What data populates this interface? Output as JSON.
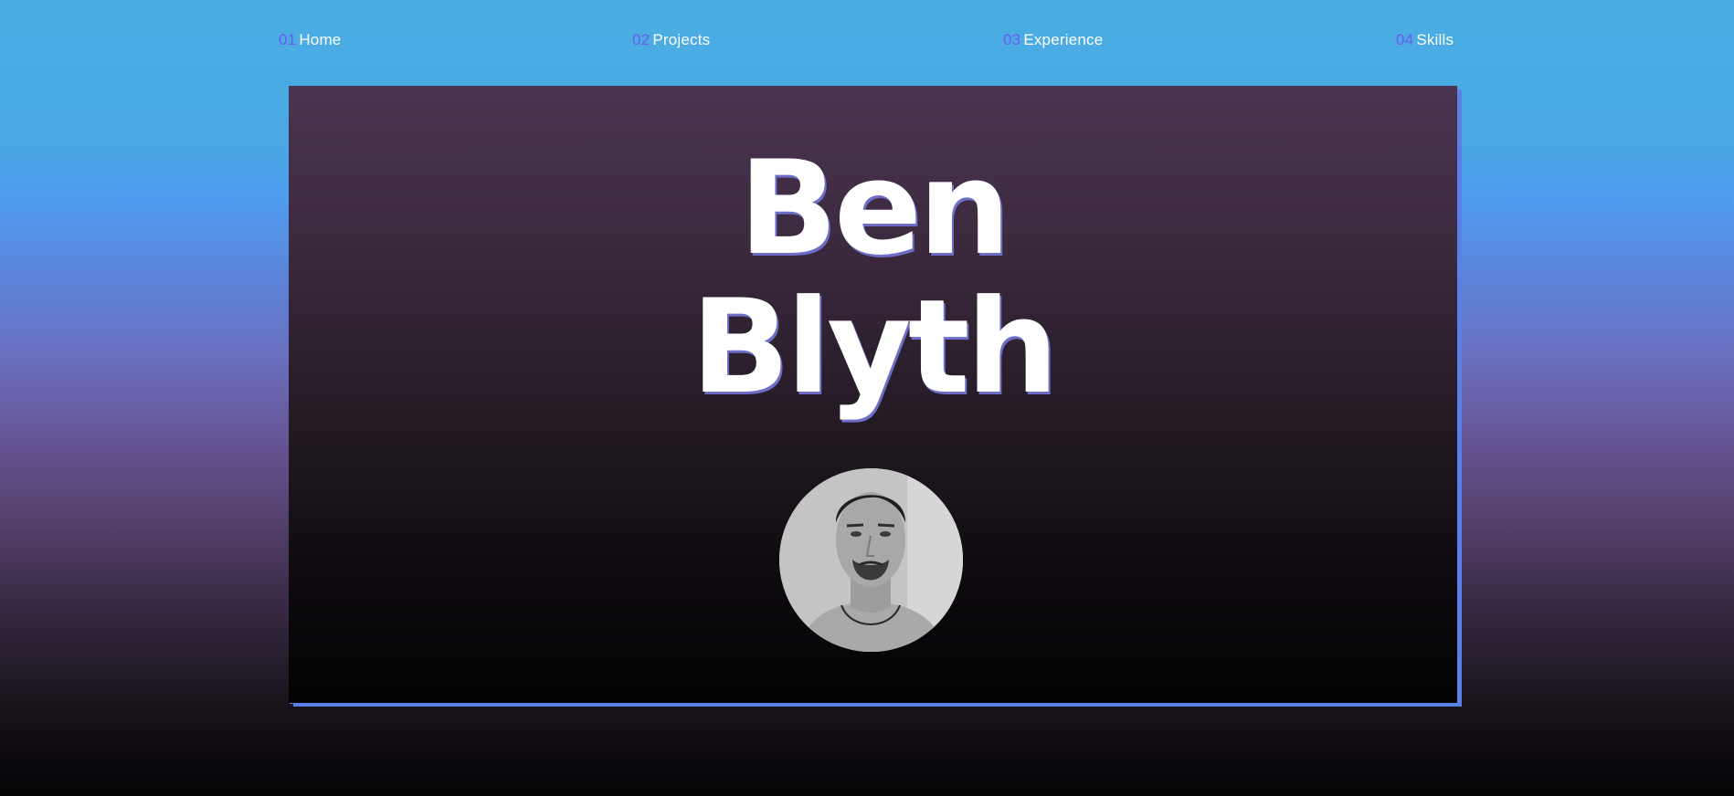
{
  "nav": {
    "items": [
      {
        "num": "01",
        "label": "Home"
      },
      {
        "num": "02",
        "label": "Projects"
      },
      {
        "num": "03",
        "label": "Experience"
      },
      {
        "num": "04",
        "label": "Skills"
      }
    ]
  },
  "hero": {
    "first_name": "Ben",
    "last_name": "Blyth"
  },
  "colors": {
    "nav_number": "#6a5cf0",
    "card_border": "#5a7fe6",
    "text": "#ffffff"
  }
}
